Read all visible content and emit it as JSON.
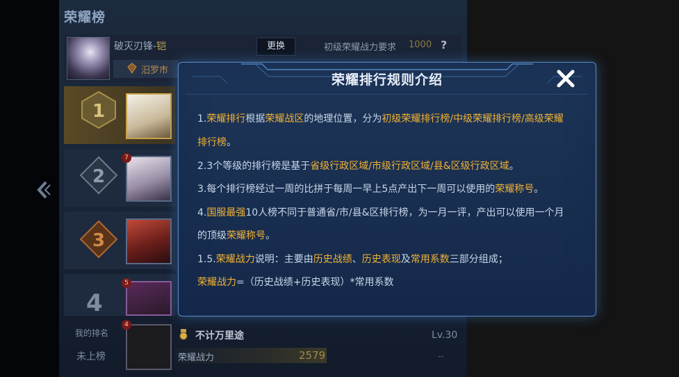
{
  "panel": {
    "title": "荣耀榜",
    "back_icon": "chevron-left-icon"
  },
  "profile": {
    "name": "破灭刃锋-",
    "name_suffix": "铠",
    "change_label": "更换",
    "requirement_label": "初级荣耀战力要求",
    "requirement_value": "1000",
    "help_label": "?",
    "region": "汨罗市"
  },
  "leaderboard": {
    "ranks": [
      {
        "rank": "1"
      },
      {
        "rank": "2",
        "level": "7"
      },
      {
        "rank": "3"
      },
      {
        "rank": "4",
        "level": "5"
      }
    ]
  },
  "my_rank": {
    "label": "我的排名",
    "value": "未上榜",
    "level_badge": "4",
    "name": "不计万里途",
    "level": "Lv.30",
    "power_label": "荣耀战力",
    "power_value": "2579",
    "dash": "--"
  },
  "modal": {
    "title": "荣耀排行规则介绍",
    "close_icon": "close-icon",
    "rules": [
      [
        {
          "t": "1."
        },
        {
          "t": "荣耀排行",
          "h": true
        },
        {
          "t": "根据"
        },
        {
          "t": "荣耀战区",
          "h": true
        },
        {
          "t": "的地理位置，分为"
        },
        {
          "t": "初级荣耀排行榜/中级荣耀排行榜/高级荣耀",
          "h": true
        }
      ],
      [
        {
          "t": "排行榜",
          "h": true
        },
        {
          "t": "。"
        }
      ],
      [
        {
          "t": "2.3个等级的排行榜是基于"
        },
        {
          "t": "省级行政区域/市级行政区域/县&区级行政区域",
          "h": true
        },
        {
          "t": "。"
        }
      ],
      [
        {
          "t": "3.每个排行榜经过一周的比拼于每周一早上5点产出下一周可以使用的"
        },
        {
          "t": "荣耀称号",
          "h": true
        },
        {
          "t": "。"
        }
      ],
      [
        {
          "t": "4."
        },
        {
          "t": "国服最强",
          "h": true
        },
        {
          "t": "10人榜不同于普通省/市/县&区排行榜，为一月一评，产出可以使用一个月"
        }
      ],
      [
        {
          "t": "的顶级"
        },
        {
          "t": "荣耀称号",
          "h": true
        },
        {
          "t": "。"
        }
      ],
      [
        {
          "t": "1.5."
        },
        {
          "t": "荣耀战力",
          "h": true
        },
        {
          "t": "说明：主要由"
        },
        {
          "t": "历史战绩",
          "h": true
        },
        {
          "t": "、"
        },
        {
          "t": "历史表现",
          "h": true
        },
        {
          "t": "及"
        },
        {
          "t": "常用系数",
          "h": true
        },
        {
          "t": "三部分组成；"
        }
      ],
      [
        {
          "t": "荣耀战力",
          "h": true
        },
        {
          "t": "=（历史战绩+历史表现）*常用系数"
        }
      ]
    ]
  },
  "colors": {
    "highlight": "#f2b233",
    "modal_border": "#5a8cc4",
    "gold": "#c9a24a"
  }
}
